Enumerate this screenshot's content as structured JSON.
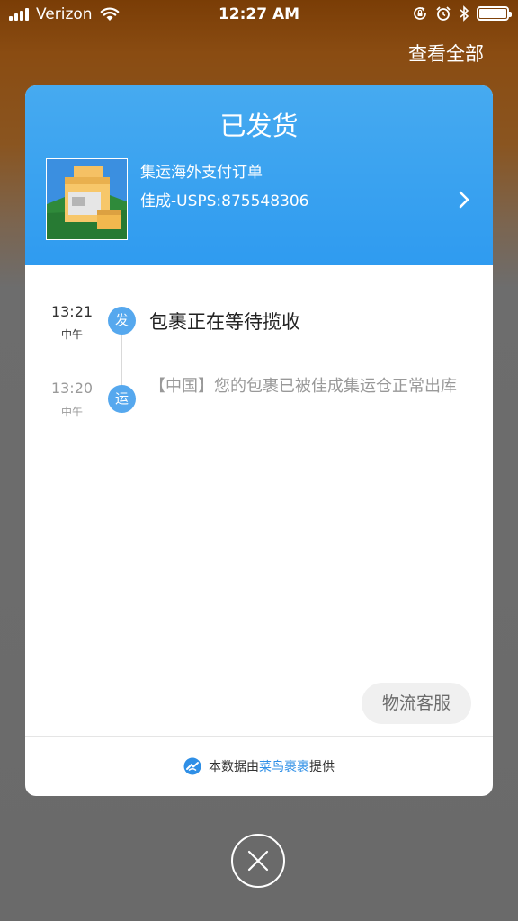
{
  "status_bar": {
    "carrier": "Verizon",
    "time": "12:27 AM"
  },
  "view_all": "查看全部",
  "card": {
    "title": "已发货",
    "order_name": "集运海外支付订单",
    "order_number": "佳成-USPS:875548306",
    "timeline": [
      {
        "time": "13:21",
        "period": "中午",
        "badge": "发",
        "text": "包裹正在等待揽收"
      },
      {
        "time": "13:20",
        "period": "中午",
        "badge": "运",
        "text": "【中国】您的包裹已被佳成集运仓正常出库"
      }
    ],
    "service_button": "物流客服",
    "footer": {
      "prefix": "本数据由",
      "brand": "菜鸟裹裹",
      "suffix": "提供"
    }
  },
  "colors": {
    "header_blue": "#3aa3f0",
    "timeline_dot": "#56a8ee",
    "brand_link": "#2f8fe6"
  },
  "icons": {
    "wifi": "wifi-icon",
    "bluetooth": "bluetooth-icon",
    "alarm": "alarm-icon",
    "rotation_lock": "rotation-lock-icon",
    "battery": "battery-icon",
    "chevron": "chevron-right-icon",
    "cainiao_logo": "cainiao-logo-icon",
    "close": "close-icon"
  }
}
